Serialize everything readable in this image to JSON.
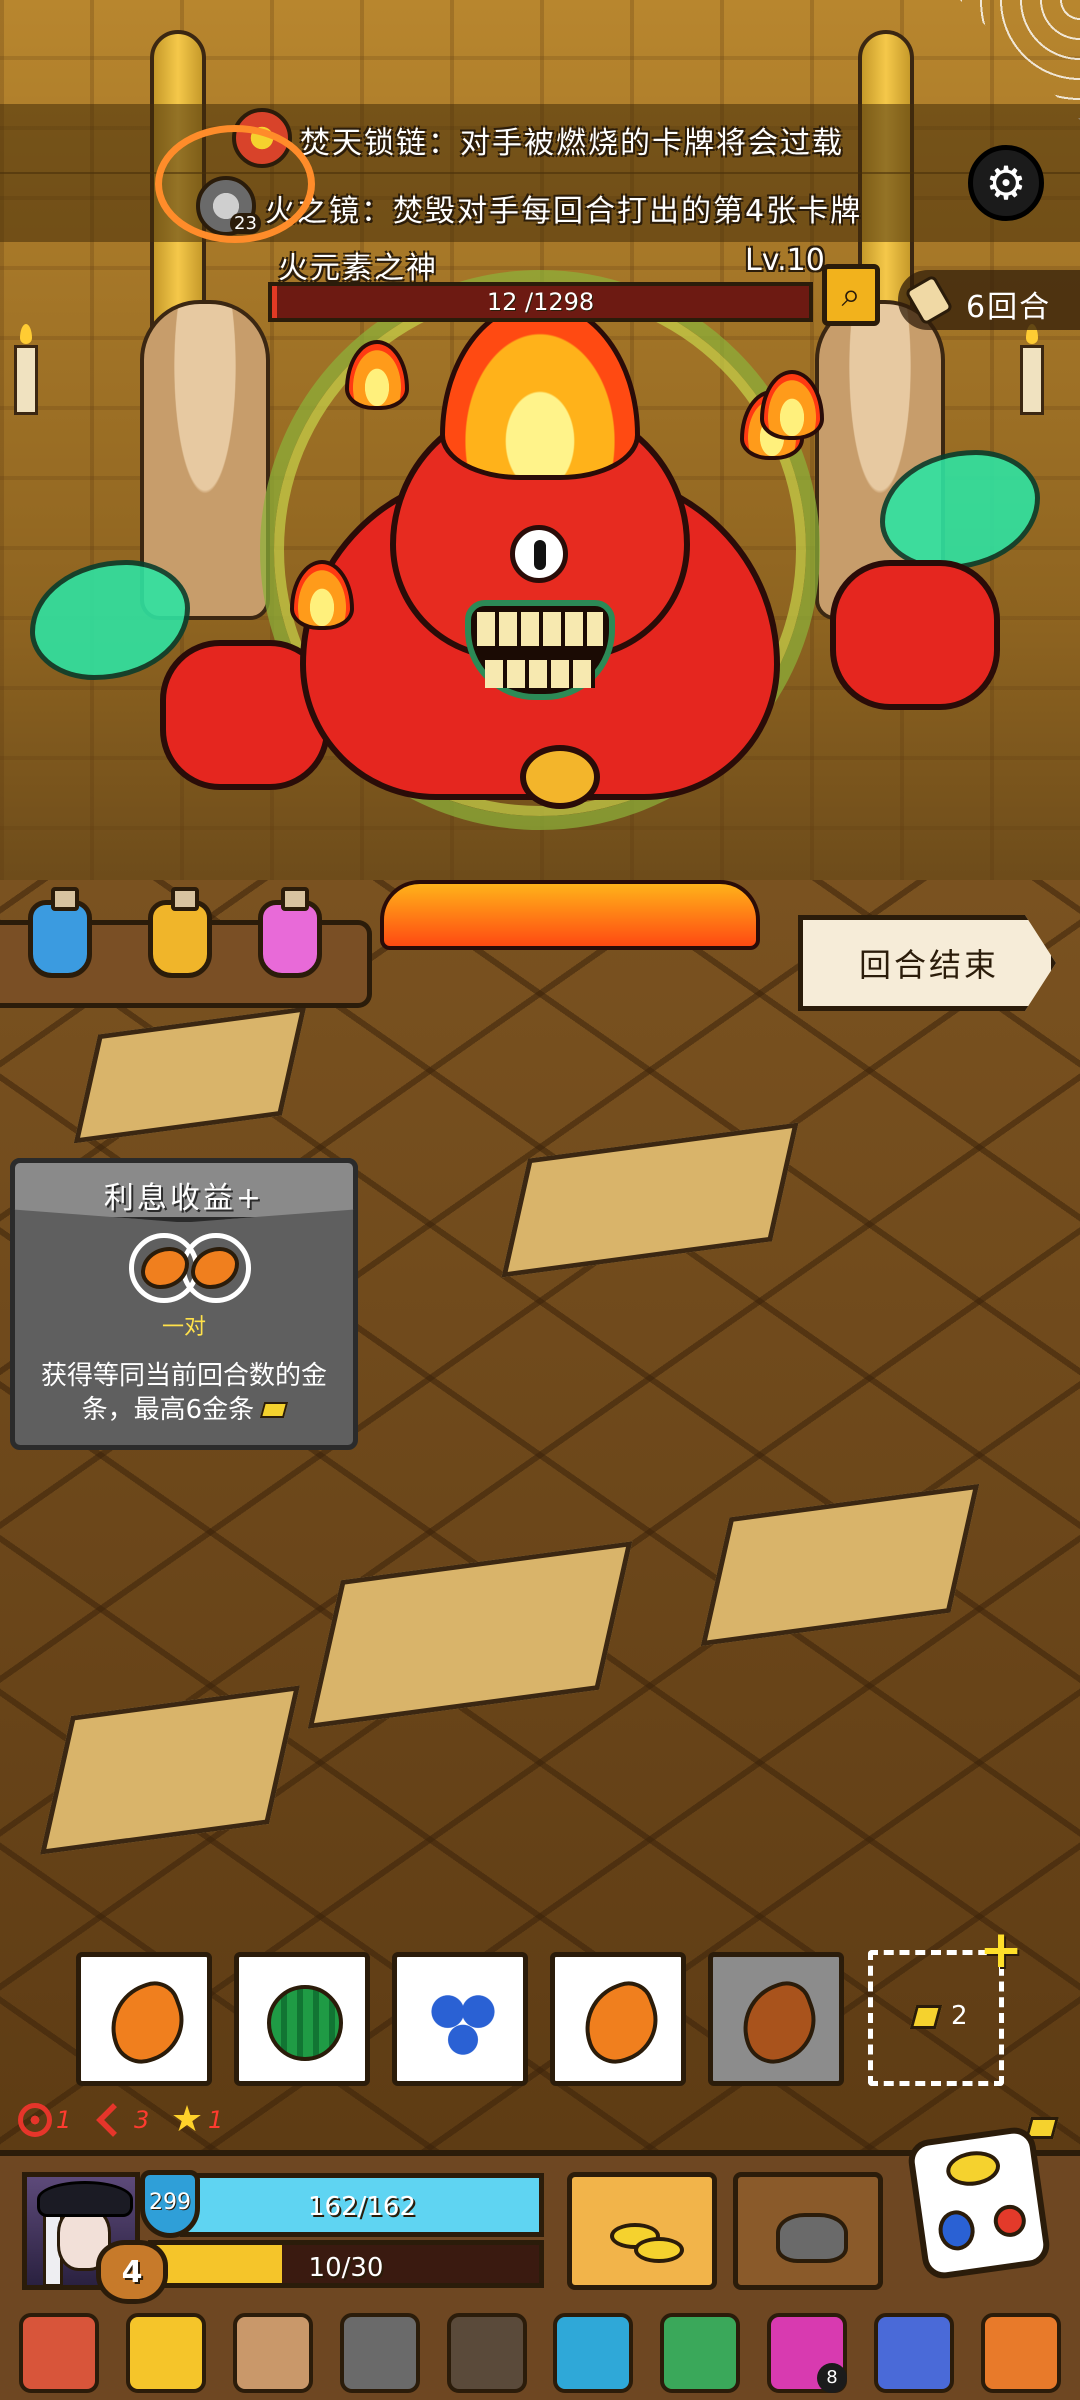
{
  "buffs": [
    {
      "icon": "burning-chain-icon",
      "text": "焚天锁链：对手被燃烧的卡牌将会过载"
    },
    {
      "icon": "fire-mirror-icon",
      "text": "火之镜：焚毁对手每回合打出的第4张卡牌",
      "count": "23"
    }
  ],
  "boss": {
    "name": "火元素之神",
    "level": "Lv.10",
    "hp_text": "12 /1298",
    "hp_fraction": 0.01
  },
  "turns": {
    "label": "6回合"
  },
  "end_turn": {
    "label": "回合结束"
  },
  "potions": [
    {
      "name": "blue-potion",
      "color": "#3b9be0"
    },
    {
      "name": "yellow-potion",
      "color": "#f0b52a"
    },
    {
      "name": "pink-potion",
      "color": "#e86ad8"
    }
  ],
  "relic_card": {
    "title": "利息收益+",
    "subtitle": "一对",
    "description": "获得等同当前回合数的金条，最高6金条"
  },
  "dice_slots": [
    {
      "fruit": "orange",
      "used": false
    },
    {
      "fruit": "melon",
      "used": false
    },
    {
      "fruit": "berry",
      "used": false
    },
    {
      "fruit": "orange",
      "used": false
    },
    {
      "fruit": "brown",
      "used": true
    }
  ],
  "gold_slot": {
    "count": "2"
  },
  "statuses": [
    {
      "icon": "target-icon",
      "value": "1"
    },
    {
      "icon": "arrow-icon",
      "value": "3"
    },
    {
      "icon": "star-icon",
      "value": "1"
    }
  ],
  "player": {
    "shield": "299",
    "hp_text": "162/162",
    "hp_fraction": 1.0,
    "exp_text": "10/30",
    "exp_fraction": 0.333,
    "gold": "4"
  },
  "colors": {
    "accent_orange": "#ff8c2a",
    "hp_blue": "#5fd4f2",
    "exp_yellow": "#f5c52a",
    "boss_red": "#e5261f"
  },
  "relic_bar": [
    {
      "name": "meat-leg-icon",
      "color": "#d8553a"
    },
    {
      "name": "crown-icon",
      "color": "#f5c52a"
    },
    {
      "name": "rock-icon",
      "color": "#c9986a"
    },
    {
      "name": "p-shield-icon",
      "color": "#6a6a6a"
    },
    {
      "name": "crossbow-icon",
      "color": "#5a4a3a"
    },
    {
      "name": "crystal-shield-icon",
      "color": "#2fa8d8"
    },
    {
      "name": "green-sponge-icon",
      "color": "#3aa85a"
    },
    {
      "name": "magic-orb-icon",
      "color": "#d83ab0",
      "badge": "8"
    },
    {
      "name": "blue-cup-icon",
      "color": "#4a6ad8"
    },
    {
      "name": "flame-relic-icon",
      "color": "#e87a2a"
    }
  ]
}
